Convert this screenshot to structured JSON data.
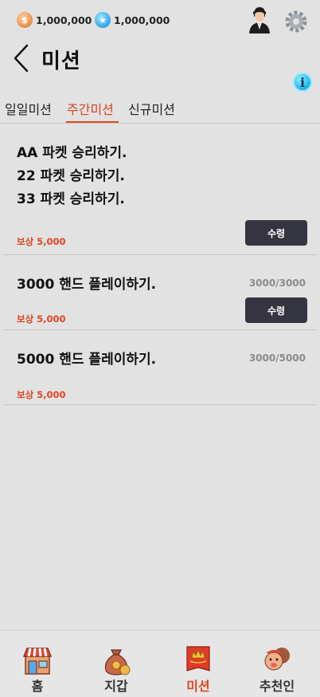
{
  "currencies": {
    "gold": {
      "amount": "1,000,000",
      "icon": "gold-coin-icon",
      "color": "#e98a4a"
    },
    "blue": {
      "amount": "1,000,000",
      "icon": "blue-star-coin-icon",
      "color": "#2aa6e8"
    }
  },
  "header": {
    "title": "미션"
  },
  "tabs": [
    {
      "label": "일일미션",
      "active": false
    },
    {
      "label": "주간미션",
      "active": true
    },
    {
      "label": "신규미션",
      "active": false
    }
  ],
  "missions": [
    {
      "lines": [
        "AA 파켓 승리하기.",
        "22 파켓 승리하기.",
        "33 파켓 승리하기."
      ],
      "progress": "",
      "reward": "보상 5,000",
      "claim_label": "수령"
    },
    {
      "lines": [
        "3000 핸드 플레이하기."
      ],
      "progress": "3000/3000",
      "reward": "보상 5,000",
      "claim_label": "수령"
    },
    {
      "lines": [
        "5000 핸드 플레이하기."
      ],
      "progress": "3000/5000",
      "reward": "보상 5,000",
      "claim_label": ""
    }
  ],
  "nav": [
    {
      "label": "홈",
      "icon": "shop-icon",
      "active": false
    },
    {
      "label": "지갑",
      "icon": "money-bag-icon",
      "active": false
    },
    {
      "label": "미션",
      "icon": "crown-banner-icon",
      "active": true
    },
    {
      "label": "추천인",
      "icon": "friends-icon",
      "active": false
    }
  ],
  "colors": {
    "accent": "#e0451f",
    "button": "#353542",
    "background": "#e2e2e2"
  }
}
